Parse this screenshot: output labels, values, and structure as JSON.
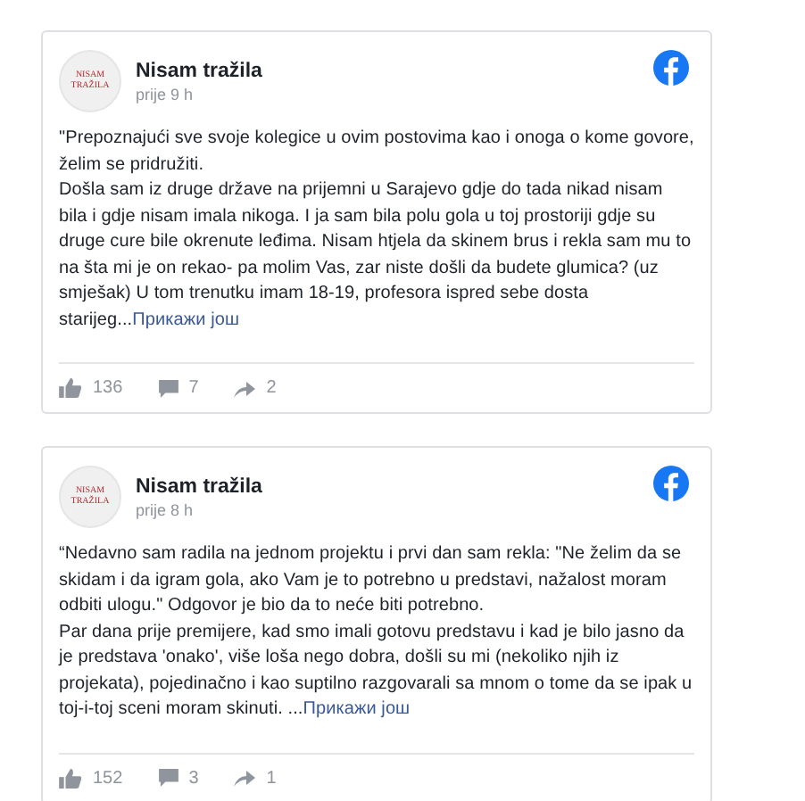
{
  "posts": [
    {
      "avatar_text": "NISAM TRAŽILA",
      "author": "Nisam tražila",
      "time": "prije 9 h",
      "paragraphs": [
        "\"Prepoznajući sve svoje kolegice u ovim postovima kao i onoga o kome govore, želim se pridružiti.",
        "Došla sam iz druge države na prijemni u Sarajevo gdje do tada nikad nisam bila i gdje nisam imala nikoga. I ja sam bila polu gola u toj prostoriji gdje su druge cure bile okrenute leđima. Nisam htjela da skinem brus i rekla sam mu to na šta mi je on rekao- pa molim Vas, zar niste došli da budete glumica? (uz smješak) U tom trenutku imam 18-19, profesora ispred sebe dosta starijeg..."
      ],
      "more": "Прикажи још",
      "likes": "136",
      "comments": "7",
      "shares": "2"
    },
    {
      "avatar_text": "NISAM TRAŽILA",
      "author": "Nisam tražila",
      "time": "prije 8 h",
      "paragraphs": [
        "“Nedavno sam radila na jednom projektu i prvi dan sam rekla: \"Ne želim da se skidam i da igram gola, ako Vam je to potrebno u predstavi, nažalost moram odbiti ulogu.\" Odgovor je bio da to neće biti potrebno.",
        "Par dana prije premijere, kad smo imali gotovu predstavu i kad je bilo jasno da je predstava 'onako', više loša nego dobra, došli su mi (nekoliko njih iz projekata), pojedinačno i kao suptilno razgovarali sa mnom o tome da se ipak u toj-i-toj sceni moram skinuti. ..."
      ],
      "more": "Прикажи још",
      "likes": "152",
      "comments": "3",
      "shares": "1"
    }
  ]
}
